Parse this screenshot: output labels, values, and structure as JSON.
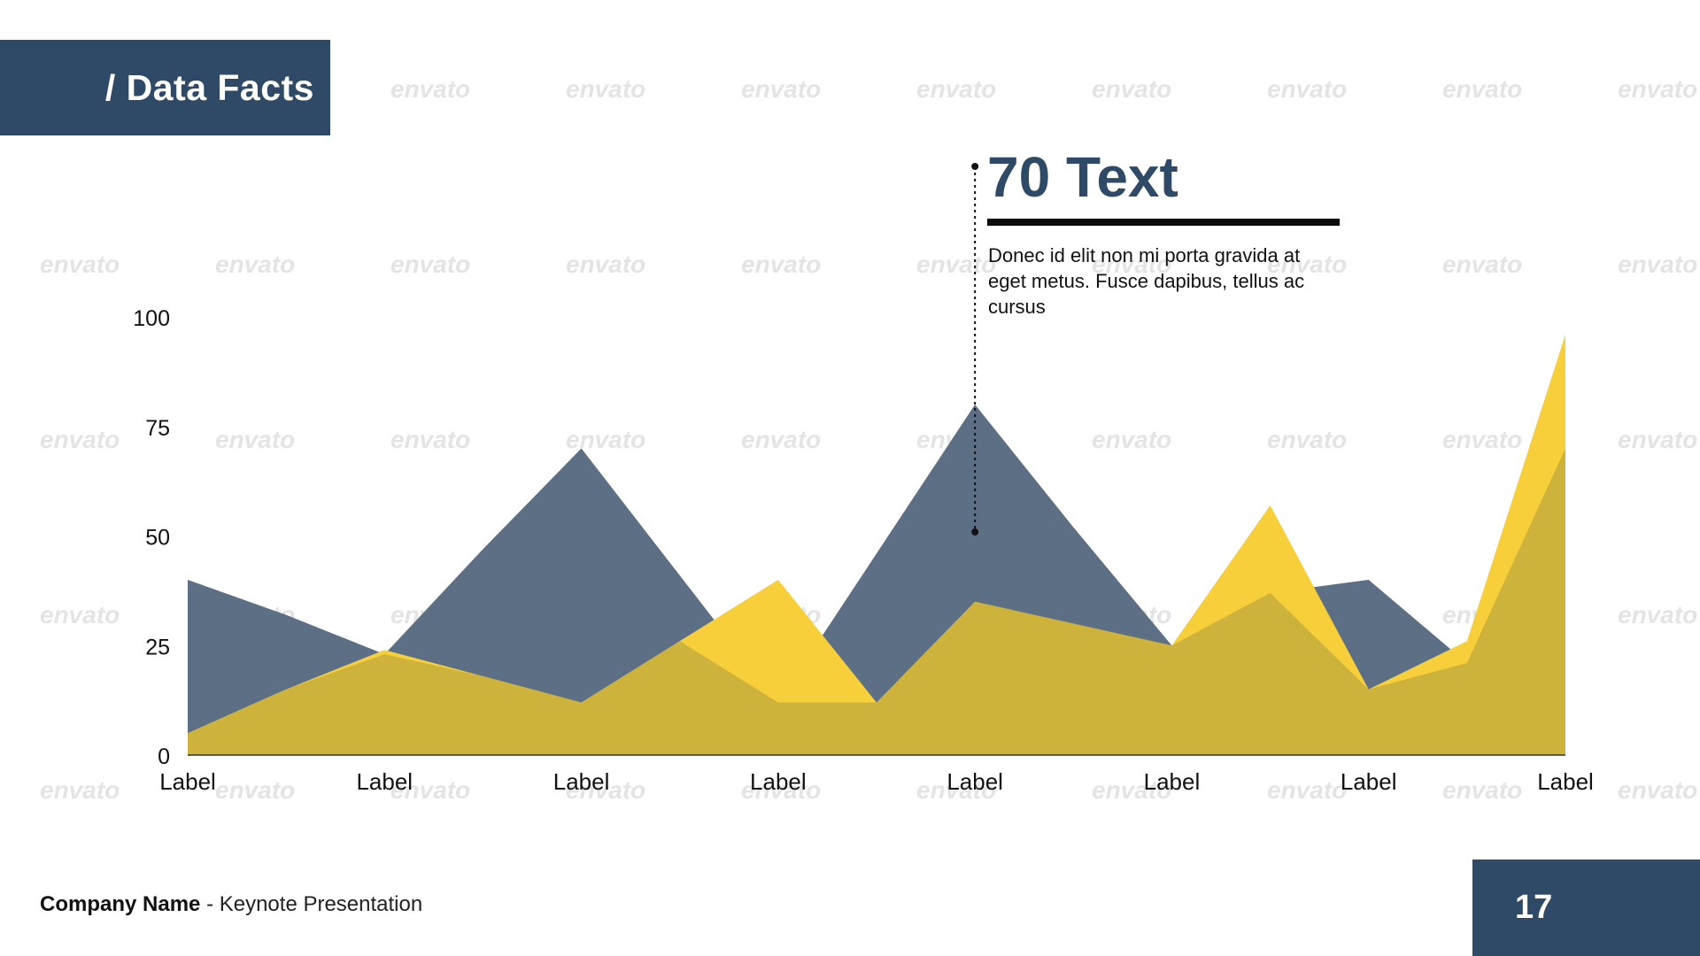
{
  "header": {
    "title": "/ Data Facts"
  },
  "watermark": {
    "text": "envato"
  },
  "callout": {
    "title": "70 Text",
    "body": "Donec id elit non mi porta gravida at eget metus. Fusce dapibus, tellus ac cursus"
  },
  "footer": {
    "company": "Company Name",
    "subtitle": "- Keynote Presentation",
    "page_number": "17"
  },
  "colors": {
    "brand_dark": "#2e4a66",
    "series_dark": "#5c6f85",
    "series_yellow": "#f6cf3a",
    "overlap": "#cdb23c",
    "axis": "#333333"
  },
  "chart_data": {
    "type": "area",
    "categories": [
      "Label",
      "Label",
      "Label",
      "Label",
      "Label",
      "Label",
      "Label",
      "Label"
    ],
    "x": [
      0,
      0.5,
      1,
      1.5,
      2,
      2.5,
      3,
      3.5,
      4,
      4.5,
      5,
      5.5,
      6,
      6.5,
      7
    ],
    "ylim": [
      0,
      100
    ],
    "yticks": [
      0,
      25,
      50,
      75,
      100
    ],
    "grid": false,
    "series": [
      {
        "values": [
          40,
          32,
          23,
          47,
          70,
          41,
          12,
          46,
          80,
          52,
          25,
          37,
          40,
          21,
          70
        ]
      },
      {
        "values": [
          5,
          15,
          24,
          18,
          12,
          26,
          40,
          12,
          35,
          30,
          25,
          57,
          15,
          26,
          96
        ]
      }
    ],
    "annotation": {
      "category_index": 4,
      "value": 80
    }
  }
}
